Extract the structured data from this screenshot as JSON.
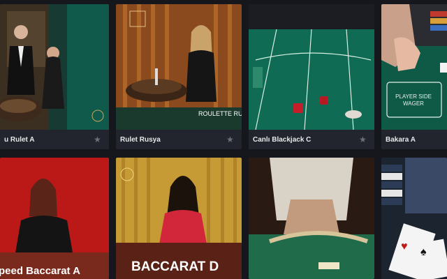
{
  "games": [
    {
      "title": "u Rulet A"
    },
    {
      "title": "Rulet Rusya",
      "overlay": "ROULETTE RUSSIA"
    },
    {
      "title": "Canlı Blackjack C"
    },
    {
      "title": "Bakara A",
      "felt_text": "PLAYER SIDE WAGER"
    }
  ],
  "games_row2": [
    {
      "overlay": "peed Baccarat A"
    },
    {
      "overlay": "BACCARAT D"
    },
    {
      "overlay": ""
    },
    {
      "overlay": ""
    }
  ],
  "icons": {
    "favorite": "star-icon"
  },
  "colors": {
    "background": "#15171c",
    "caption": "#22252d",
    "star": "#6d707a"
  }
}
